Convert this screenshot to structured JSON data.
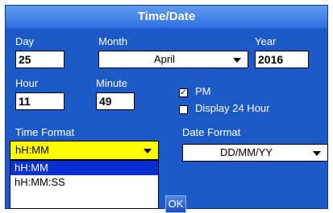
{
  "dialog": {
    "title": "Time/Date"
  },
  "date": {
    "day_label": "Day",
    "day_value": "25",
    "month_label": "Month",
    "month_value": "April",
    "year_label": "Year",
    "year_value": "2016"
  },
  "time": {
    "hour_label": "Hour",
    "hour_value": "11",
    "minute_label": "Minute",
    "minute_value": "49",
    "pm_label": "PM",
    "pm_checked": true,
    "display24_label": "Display 24 Hour",
    "display24_checked": false
  },
  "time_format": {
    "label": "Time Format",
    "value": "hH:MM",
    "options": [
      "hH:MM",
      "hH:MM:SS"
    ],
    "highlight_color": "#ffff00"
  },
  "date_format": {
    "label": "Date Format",
    "value": "DD/MM/YY"
  },
  "buttons": {
    "ok_label": "OK"
  }
}
